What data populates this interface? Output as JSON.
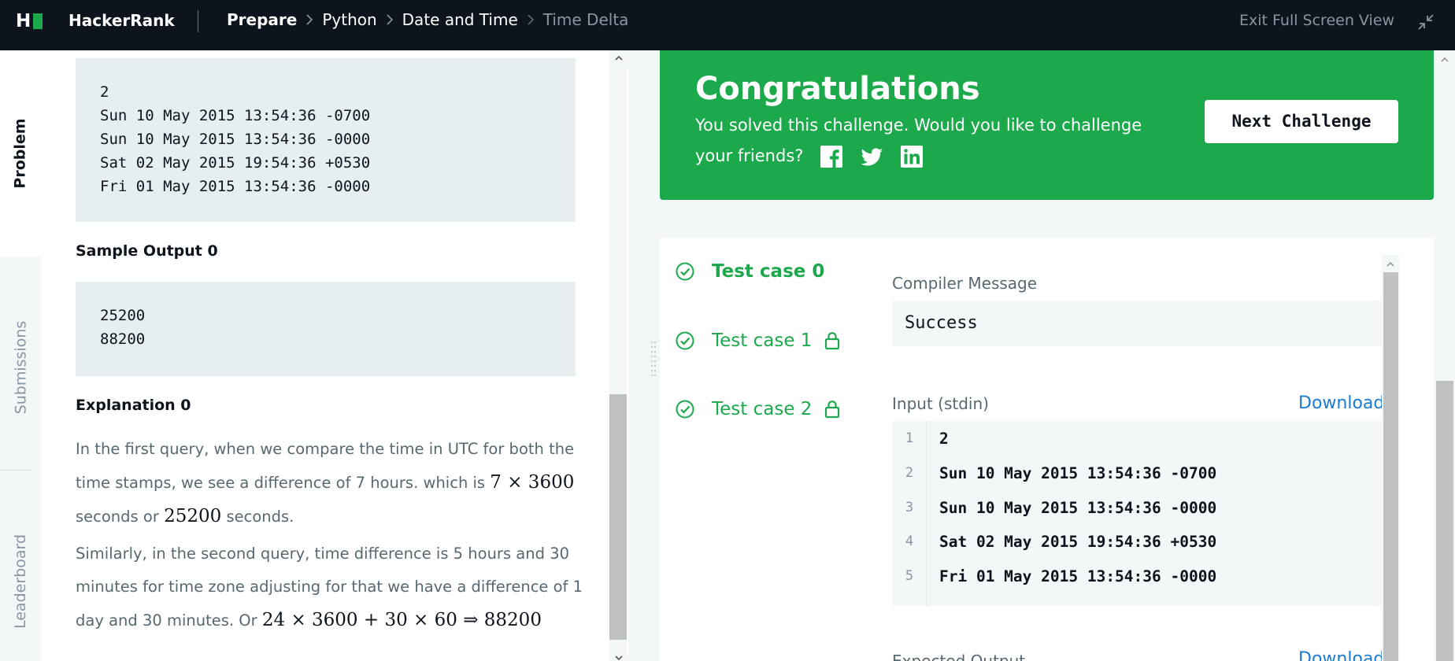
{
  "topbar": {
    "logo_letter": "H",
    "brand": "HackerRank",
    "breadcrumbs": [
      "Prepare",
      "Python",
      "Date and Time",
      "Time Delta"
    ],
    "exit_full_screen": "Exit Full Screen View"
  },
  "tabs": {
    "problem": "Problem",
    "submissions": "Submissions",
    "leaderboard": "Leaderboard"
  },
  "problem": {
    "sample_input_lines": "2\nSun 10 May 2015 13:54:36 -0700\nSun 10 May 2015 13:54:36 -0000\nSat 02 May 2015 19:54:36 +0530\nFri 01 May 2015 13:54:36 -0000",
    "sample_output_heading": "Sample Output 0",
    "sample_output_lines": "25200\n88200",
    "explanation_heading": "Explanation 0",
    "explanation_p1_text": "In the first query, when we compare the time in UTC for both the time stamps, we see a difference of 7 hours. which is",
    "explanation_p1_math1": "7 × 3600",
    "explanation_p1_mid": "seconds or",
    "explanation_p1_math2": "25200",
    "explanation_p1_end": "seconds.",
    "explanation_p2_text": "Similarly, in the second query, time difference is 5 hours and 30 minutes for time zone adjusting for that we have a difference of 1 day and 30 minutes. Or",
    "explanation_p2_math": "24 × 3600 + 30 × 60 ⇒ 88200"
  },
  "congrats": {
    "title": "Congratulations",
    "message": "You solved this challenge. Would you like to challenge your friends?",
    "next_button": "Next Challenge",
    "social_icons": [
      "facebook-icon",
      "twitter-icon",
      "linkedin-icon"
    ]
  },
  "results": {
    "test_cases": [
      {
        "label": "Test case 0",
        "locked": false,
        "active": true
      },
      {
        "label": "Test case 1",
        "locked": true,
        "active": false
      },
      {
        "label": "Test case 2",
        "locked": true,
        "active": false
      }
    ],
    "compiler_message_label": "Compiler Message",
    "compiler_message": "Success",
    "input_label": "Input (stdin)",
    "download_label": "Download",
    "stdin_lines": [
      {
        "n": "1",
        "text": "2"
      },
      {
        "n": "2",
        "text": "Sun 10 May 2015 13:54:36 -0700"
      },
      {
        "n": "3",
        "text": "Sun 10 May 2015 13:54:36 -0000"
      },
      {
        "n": "4",
        "text": "Sat 02 May 2015 19:54:36 +0530"
      },
      {
        "n": "5",
        "text": "Fri 01 May 2015 13:54:36 -0000"
      }
    ],
    "expected_output_label": "Expected Output"
  },
  "colors": {
    "topbar_bg": "#0e141e",
    "brand_green": "#1ba94c",
    "link_blue": "#1b7bd3",
    "code_bg": "#e7eeef"
  }
}
